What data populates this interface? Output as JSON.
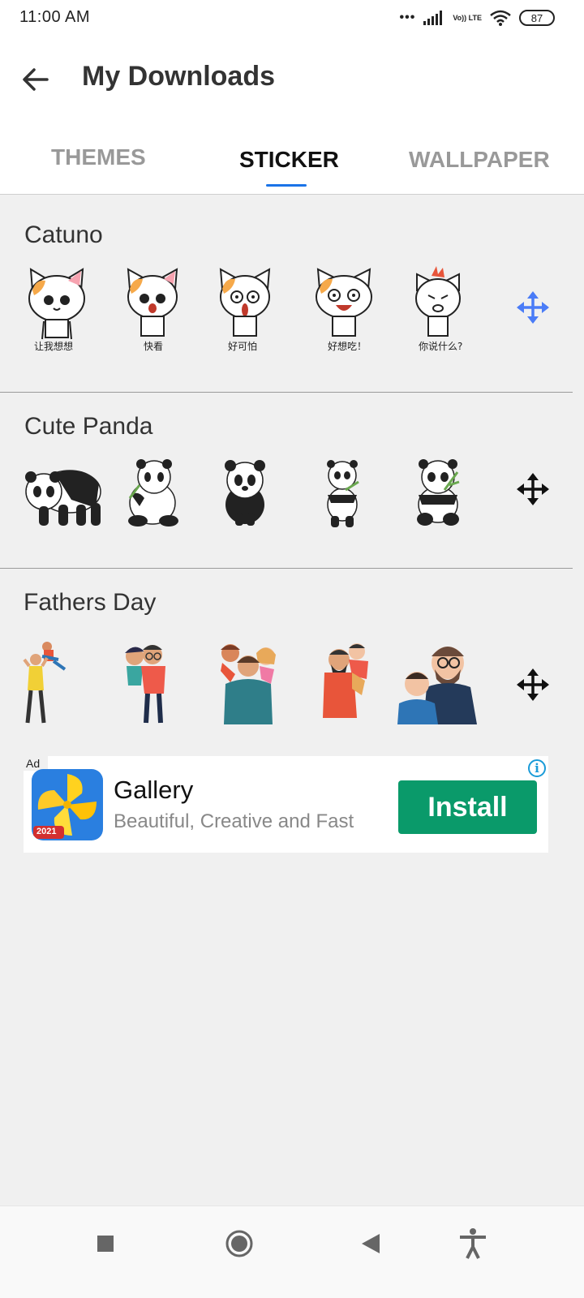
{
  "status_bar": {
    "time": "11:00 AM",
    "dots": "•••",
    "volte": "Vo)) LTE",
    "battery": "87"
  },
  "app_bar": {
    "title": "My Downloads",
    "back_icon": "arrow-left-icon"
  },
  "tabs": [
    {
      "label": "THEMES",
      "selected": false
    },
    {
      "label": "STICKER",
      "selected": true
    },
    {
      "label": "WALLPAPER",
      "selected": false
    }
  ],
  "accent_color": "#1a73e8",
  "packs": [
    {
      "title": "Catuno",
      "captions": [
        "让我想想",
        "快看",
        "好可怕",
        "好想吃！",
        "你说什么?"
      ],
      "move_icon_color": "#4a7cf7"
    },
    {
      "title": "Cute Panda",
      "move_icon_color": "#111111"
    },
    {
      "title": "Fathers Day",
      "move_icon_color": "#111111"
    }
  ],
  "ad": {
    "badge": "Ad",
    "app_name": "Gallery",
    "tagline": "Beautiful, Creative and Fast",
    "icon_badge": "2021",
    "install_label": "Install",
    "info_icon": "info-icon",
    "install_color": "#0a9a6a"
  },
  "nav_bar": {
    "icons": [
      "square-recents-icon",
      "circle-home-icon",
      "triangle-back-icon",
      "accessibility-icon"
    ]
  }
}
